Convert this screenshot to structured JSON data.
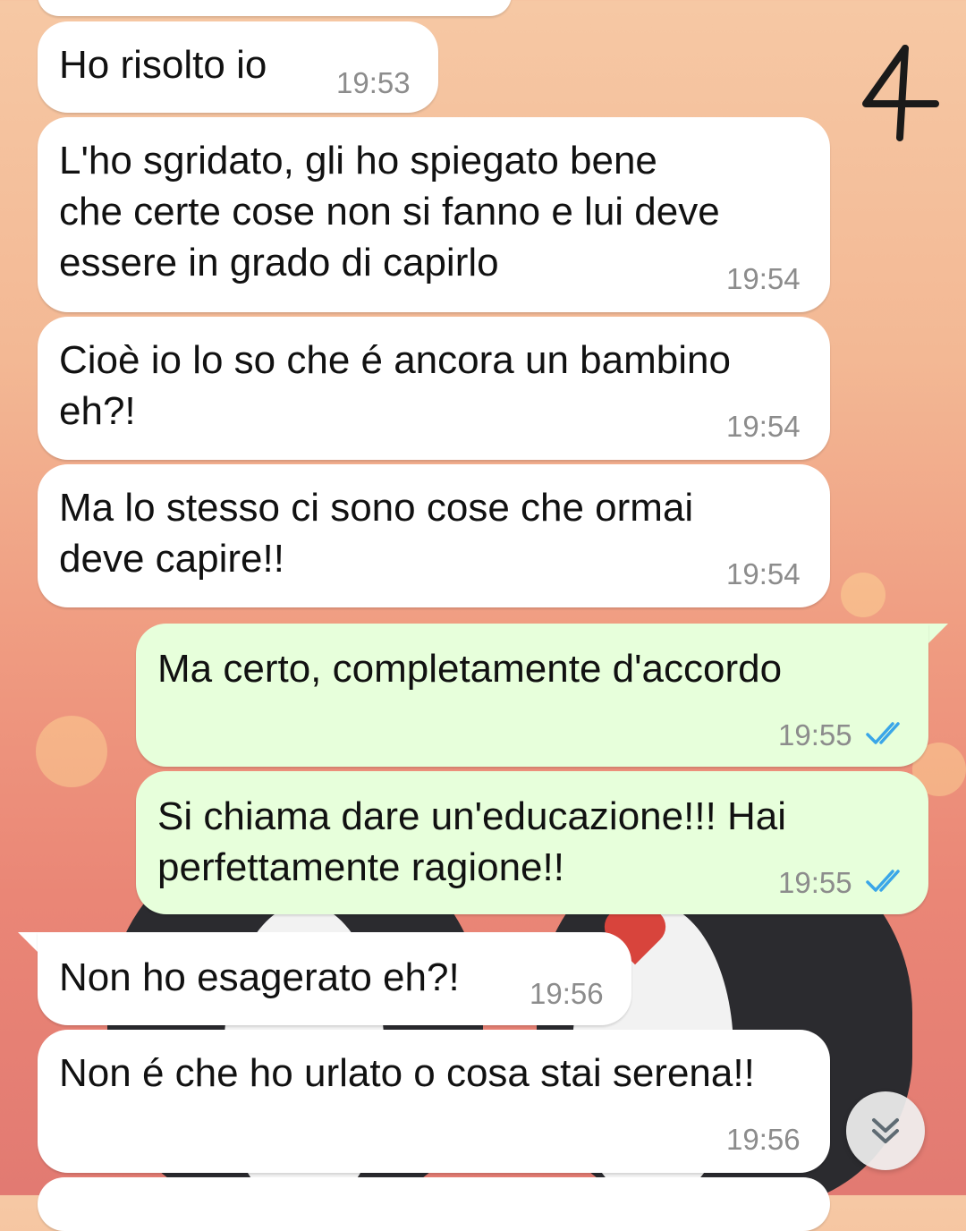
{
  "annotation": "4",
  "messages": [
    {
      "dir": "in",
      "text": "Ho risolto io",
      "time": "19:53"
    },
    {
      "dir": "in",
      "text": "L'ho sgridato, gli ho spiegato bene\nche certe cose non si fanno e lui deve\nessere in grado di capirlo",
      "time": "19:54"
    },
    {
      "dir": "in",
      "text": "Cioè io lo so che é ancora un bambino\neh?!",
      "time": "19:54"
    },
    {
      "dir": "in",
      "text": "Ma lo stesso ci sono cose che ormai\ndeve capire!!",
      "time": "19:54"
    },
    {
      "dir": "out",
      "text": "Ma certo, completamente d'accordo",
      "time": "19:55",
      "status": "read"
    },
    {
      "dir": "out",
      "text": "Si chiama dare un'educazione!!! Hai\nperfettamente ragione!!",
      "time": "19:55",
      "status": "read"
    },
    {
      "dir": "in",
      "text": "Non ho esagerato eh?!",
      "time": "19:56"
    },
    {
      "dir": "in",
      "text": "Non é che ho urlato o cosa stai serena!!",
      "time": "19:56"
    }
  ],
  "colors": {
    "incoming": "#ffffff",
    "outgoing": "#e7ffdb",
    "read_ticks": "#3aa6e8"
  },
  "icons": {
    "read_status": "double-check-icon",
    "scroll_down": "double-chevron-down-icon"
  }
}
